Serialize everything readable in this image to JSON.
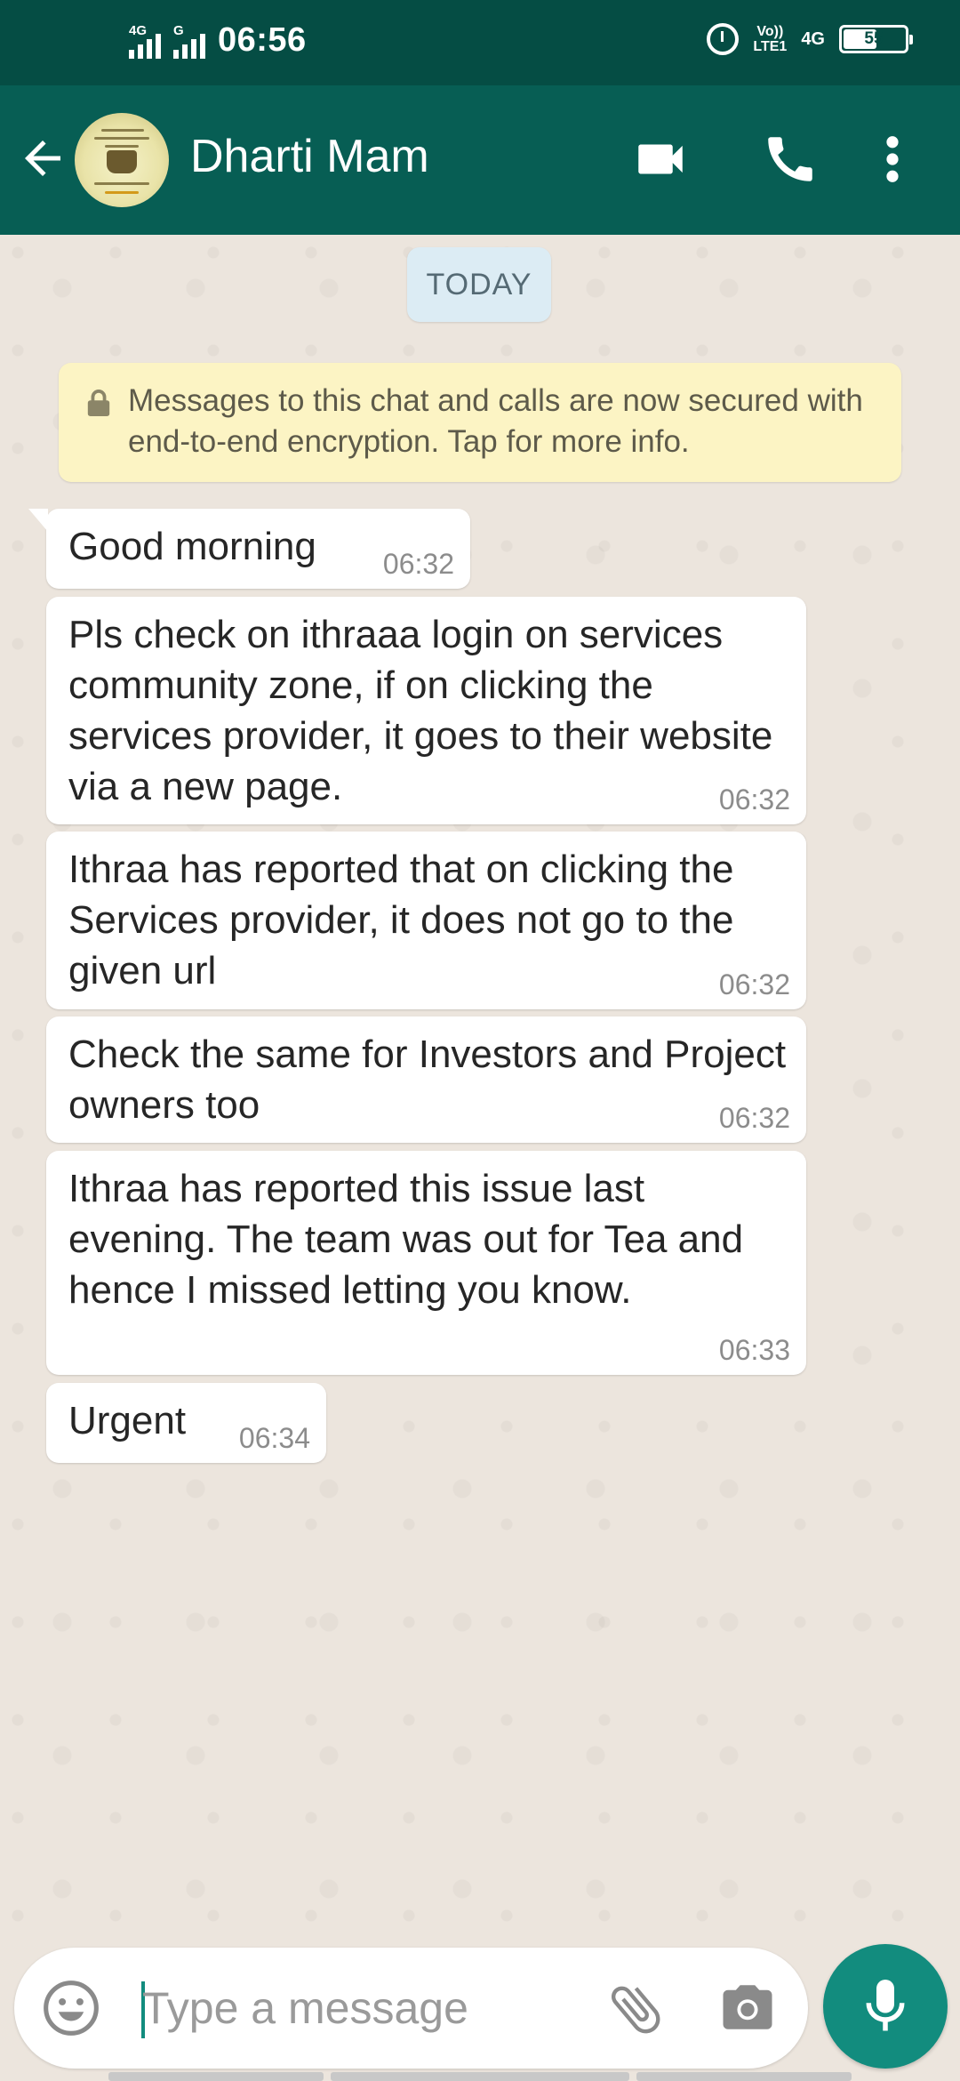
{
  "status_bar": {
    "network_1": "4G",
    "network_2": "G",
    "time": "06:56",
    "volte_line1": "Vo))",
    "volte_line2": "LTE1",
    "network_right": "4G",
    "battery": "55"
  },
  "header": {
    "contact_name": "Dharti Mam"
  },
  "chat": {
    "date_chip": "TODAY",
    "encryption_notice": "Messages to this chat and calls are now secured with end-to-end encryption. Tap for more info.",
    "messages": [
      {
        "text": "Good morning",
        "time": "06:32"
      },
      {
        "text": "Pls check on ithraaa login on services community zone, if on clicking the services provider, it goes to their website via a new page.",
        "time": "06:32"
      },
      {
        "text": "Ithraa has reported that on clicking the  Services provider, it does not go to the given url",
        "time": "06:32"
      },
      {
        "text": "Check the same for Investors and Project owners too",
        "time": "06:32"
      },
      {
        "text": "Ithraa has reported this issue last evening. The team was out for Tea and hence I missed letting you know.",
        "time": "06:33"
      },
      {
        "text": "Urgent",
        "time": "06:34"
      }
    ]
  },
  "composer": {
    "placeholder": "Type a message",
    "value": ""
  },
  "icons": {
    "back": "arrow-left-icon",
    "video": "video-camera-icon",
    "call": "phone-icon",
    "menu": "more-vertical-icon",
    "lock": "lock-icon",
    "emoji": "emoji-icon",
    "attach": "paperclip-icon",
    "camera": "camera-icon",
    "mic": "microphone-icon"
  },
  "colors": {
    "status_bar": "#054d44",
    "header": "#075e54",
    "accent": "#128c7e",
    "chat_background": "#ece5dd",
    "bubble": "#ffffff",
    "encryption_notice": "#fcf4c4",
    "date_chip": "#dcecf4"
  }
}
